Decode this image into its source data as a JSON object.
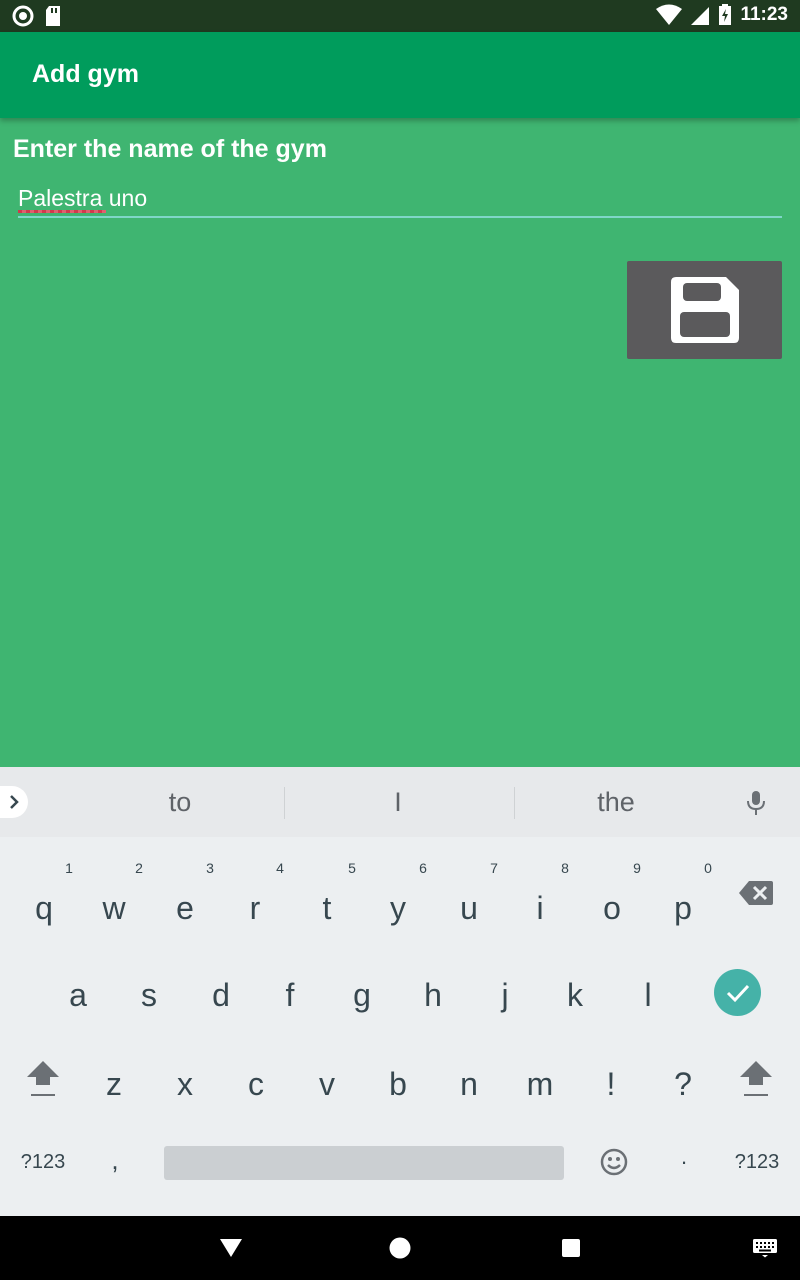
{
  "status_bar": {
    "time": "11:23",
    "icons": [
      "sync-icon",
      "sd-card-icon",
      "wifi-icon",
      "cell-signal-icon",
      "battery-charging-icon"
    ]
  },
  "app_bar": {
    "title": "Add gym"
  },
  "form": {
    "prompt": "Enter the name of the gym",
    "gym_name_value": "Palestra uno",
    "save_icon": "floppy-disk-icon"
  },
  "keyboard": {
    "suggestions": [
      "to",
      "I",
      "the"
    ],
    "row1": [
      {
        "ch": "q",
        "num": "1"
      },
      {
        "ch": "w",
        "num": "2"
      },
      {
        "ch": "e",
        "num": "3"
      },
      {
        "ch": "r",
        "num": "4"
      },
      {
        "ch": "t",
        "num": "5"
      },
      {
        "ch": "y",
        "num": "6"
      },
      {
        "ch": "u",
        "num": "7"
      },
      {
        "ch": "i",
        "num": "8"
      },
      {
        "ch": "o",
        "num": "9"
      },
      {
        "ch": "p",
        "num": "0"
      }
    ],
    "row2": [
      "a",
      "s",
      "d",
      "f",
      "g",
      "h",
      "j",
      "k",
      "l"
    ],
    "row3": [
      "z",
      "x",
      "c",
      "v",
      "b",
      "n",
      "m",
      "!",
      "?"
    ],
    "symbols_label": "?123",
    "comma": ",",
    "period": "·",
    "colors": {
      "accent": "#45b2a8",
      "bg": "#eceff1"
    }
  },
  "nav_bar": {
    "icons": [
      "back-icon",
      "home-icon",
      "recents-icon",
      "keyboard-switch-icon"
    ]
  },
  "colors": {
    "status_bar": "#1f3a20",
    "app_bar": "#009c5c",
    "content": "#3fb571",
    "save_button": "#5b5a5c"
  }
}
